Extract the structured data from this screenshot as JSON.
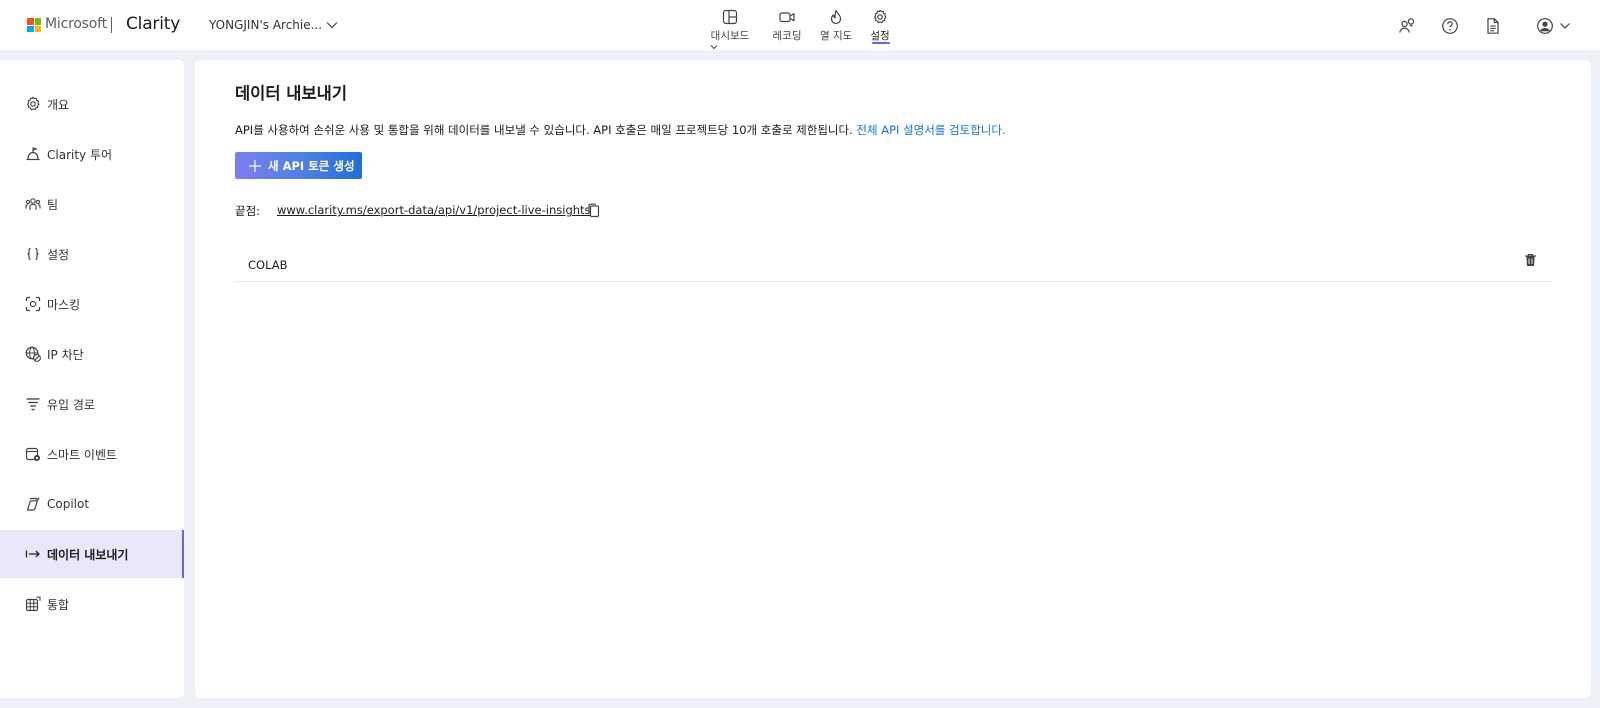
{
  "brand": {
    "microsoft": "Microsoft",
    "product": "Clarity",
    "logo_colors": [
      "#f25022",
      "#7fba00",
      "#00a4ef",
      "#ffb900"
    ]
  },
  "header": {
    "project_name": "YONGJIN's Archie...",
    "nav": [
      {
        "label": "대시보드",
        "icon": "dashboard-icon",
        "has_dropdown": true
      },
      {
        "label": "레코딩",
        "icon": "video-icon"
      },
      {
        "label": "열 지도",
        "icon": "flame-icon"
      },
      {
        "label": "설정",
        "icon": "gear-icon",
        "active": true
      }
    ],
    "right_icons": [
      "share-people-icon",
      "help-icon",
      "document-icon",
      "account-icon"
    ]
  },
  "sidebar": {
    "items": [
      {
        "label": "개요",
        "icon": "gear-icon"
      },
      {
        "label": "Clarity 투어",
        "icon": "tour-icon"
      },
      {
        "label": "팀",
        "icon": "team-icon"
      },
      {
        "label": "설정",
        "icon": "braces-icon"
      },
      {
        "label": "마스킹",
        "icon": "masking-icon"
      },
      {
        "label": "IP 차단",
        "icon": "globe-block-icon"
      },
      {
        "label": "유입 경로",
        "icon": "funnel-icon"
      },
      {
        "label": "스마트 이벤트",
        "icon": "smart-event-icon"
      },
      {
        "label": "Copilot",
        "icon": "copilot-icon"
      },
      {
        "label": "데이터 내보내기",
        "icon": "export-arrow-icon",
        "active": true
      },
      {
        "label": "통합",
        "icon": "integration-grid-icon"
      }
    ],
    "active_color": "#6b63e0"
  },
  "main": {
    "title": "데이터 내보내기",
    "description": "API를 사용하여 손쉬운 사용 및 통합을 위해 데이터를 내보낼 수 있습니다. API 호출은 매일 프로젝트당 10개 호출로 제한됩니다.",
    "doc_link": "전체 API 설명서를 검토합니다.",
    "new_token_button": "새 API 토큰 생성",
    "endpoint_label": "끝점:",
    "endpoint_url": "www.clarity.ms/export-data/api/v1/project-live-insights",
    "tokens": [
      {
        "name": "COLAB"
      }
    ],
    "link_color": "#1473d2"
  }
}
